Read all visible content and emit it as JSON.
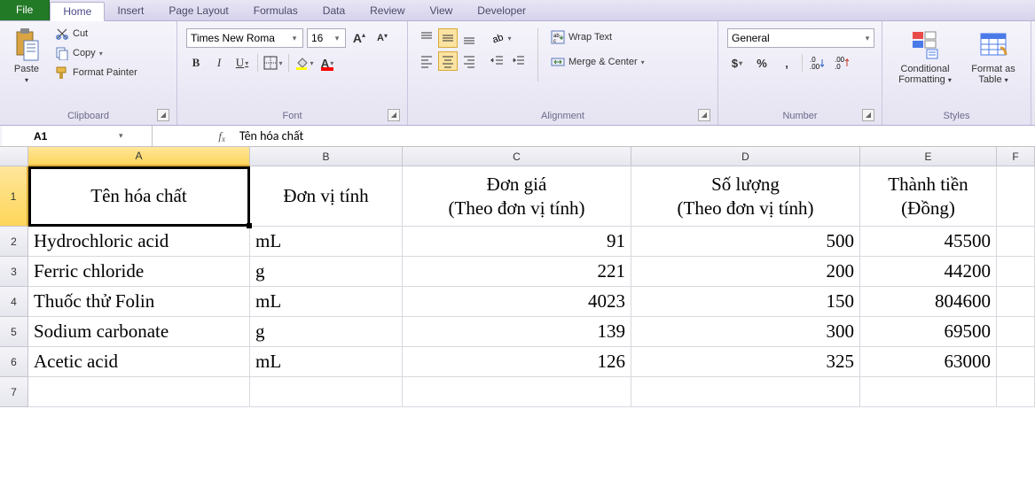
{
  "tabs": {
    "file": "File",
    "items": [
      "Home",
      "Insert",
      "Page Layout",
      "Formulas",
      "Data",
      "Review",
      "View",
      "Developer"
    ],
    "active": "Home"
  },
  "ribbon": {
    "clipboard": {
      "label": "Clipboard",
      "paste": "Paste",
      "cut": "Cut",
      "copy": "Copy",
      "format_painter": "Format Painter"
    },
    "font": {
      "label": "Font",
      "name": "Times New Roma",
      "size": "16",
      "bold": "B",
      "italic": "I",
      "underline": "U"
    },
    "alignment": {
      "label": "Alignment",
      "wrap": "Wrap Text",
      "merge": "Merge & Center"
    },
    "number": {
      "label": "Number",
      "format": "General",
      "currency": "$",
      "percent": "%",
      "comma": ","
    },
    "styles": {
      "label": "Styles",
      "conditional": "Conditional Formatting",
      "as_table": "Format as Table"
    }
  },
  "namebox": "A1",
  "formula": "Tên hóa chất",
  "columns": [
    "A",
    "B",
    "C",
    "D",
    "E",
    "F"
  ],
  "active_col": "A",
  "active_row": 1,
  "headers": {
    "A": "Tên hóa chất",
    "B": "Đơn vị tính",
    "C": "Đơn giá\n(Theo đơn vị tính)",
    "D": "Số lượng\n(Theo đơn vị tính)",
    "E": "Thành tiền\n(Đồng)"
  },
  "rows": [
    {
      "A": "Hydrochloric acid",
      "B": "mL",
      "C": "91",
      "D": "500",
      "E": "45500"
    },
    {
      "A": "Ferric chloride",
      "B": "g",
      "C": "221",
      "D": "200",
      "E": "44200"
    },
    {
      "A": "Thuốc thử Folin",
      "B": "mL",
      "C": "4023",
      "D": "150",
      "E": "804600"
    },
    {
      "A": "Sodium carbonate",
      "B": "g",
      "C": "139",
      "D": "300",
      "E": "69500"
    },
    {
      "A": "Acetic acid",
      "B": "mL",
      "C": "126",
      "D": "325",
      "E": "63000"
    }
  ],
  "chart_data": {
    "type": "table",
    "title": "",
    "columns": [
      "Tên hóa chất",
      "Đơn vị tính",
      "Đơn giá (Theo đơn vị tính)",
      "Số lượng (Theo đơn vị tính)",
      "Thành tiền (Đồng)"
    ],
    "data": [
      [
        "Hydrochloric acid",
        "mL",
        91,
        500,
        45500
      ],
      [
        "Ferric chloride",
        "g",
        221,
        200,
        44200
      ],
      [
        "Thuốc thử Folin",
        "mL",
        4023,
        150,
        804600
      ],
      [
        "Sodium carbonate",
        "g",
        139,
        300,
        69500
      ],
      [
        "Acetic acid",
        "mL",
        126,
        325,
        63000
      ]
    ]
  }
}
